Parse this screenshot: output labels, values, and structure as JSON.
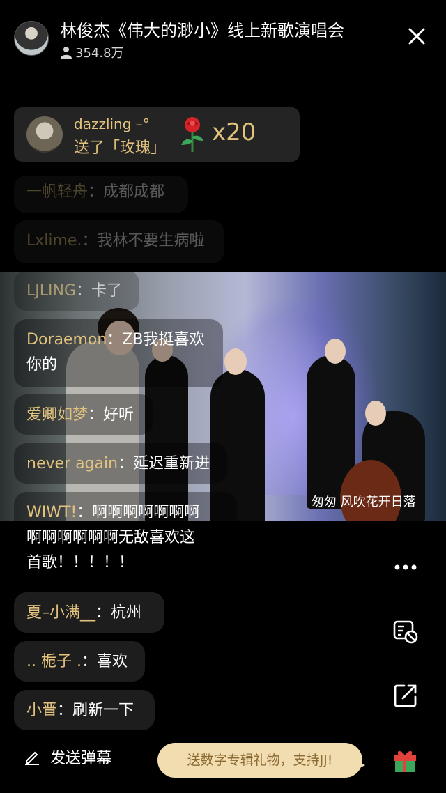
{
  "header": {
    "title": "林俊杰《伟大的渺小》线上新歌演唱会",
    "viewers": "354.8万"
  },
  "gift": {
    "user": "dazzling –°",
    "text": "送了「玫瑰」",
    "count": "x20"
  },
  "chat": [
    {
      "nick": "一帆轻舟",
      "sep": "：",
      "msg": "成都成都"
    },
    {
      "nick": "Lxlime.",
      "sep": "：",
      "msg": "我林不要生病啦"
    },
    {
      "nick": "LJLING",
      "sep": "：",
      "msg": "卡了"
    },
    {
      "nick": "Doraemon",
      "sep": "：",
      "msg": "ZB我挺喜欢",
      "msg2": "你的"
    },
    {
      "nick": "爱卿如梦",
      "sep": "：",
      "msg": "好听"
    },
    {
      "nick": "never again",
      "sep": "：",
      "msg": "延迟重新进"
    },
    {
      "nick": "WIWT!",
      "sep": "：",
      "msg": "啊啊啊啊啊啊啊",
      "msg2": "啊啊啊啊啊啊无敌喜欢这",
      "msg3": "首歌！！！！！"
    },
    {
      "nick": "夏–小满__",
      "sep": "：",
      "msg": "杭州"
    },
    {
      "nick": ".. 栀子 .",
      "sep": "：",
      "msg": "喜欢"
    },
    {
      "nick": "小晋",
      "sep": "：",
      "msg": "刷新一下"
    }
  ],
  "video": {
    "subtitle": "匆匆 风吹花开日落"
  },
  "footer": {
    "send_label": "发送弹幕",
    "promo": "送数字专辑礼物，支持JJ!"
  },
  "icons": [
    "close-icon",
    "person-icon",
    "more-icon",
    "danmaku-off-icon",
    "share-icon",
    "gift-icon",
    "pencil-icon",
    "rose-icon"
  ],
  "colors": {
    "accent": "#e2c37e",
    "promo_bg": "#f2ddb1",
    "gift_green": "#3aa75a",
    "gift_red": "#e0433b"
  }
}
